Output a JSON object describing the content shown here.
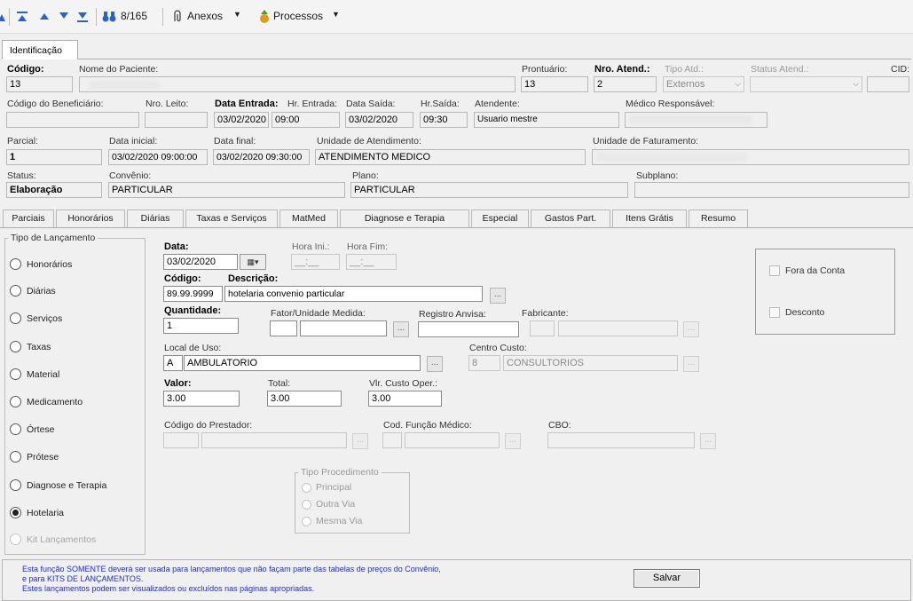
{
  "toolbar": {
    "counter": "8/165",
    "attachments_label": "Anexos",
    "processes_label": "Processos"
  },
  "tabs_top": {
    "identificacao": "Identificação"
  },
  "header": {
    "codigo_label": "Código:",
    "codigo_value": "13",
    "nome_label": "Nome do Paciente:",
    "nome_value": "",
    "prontuario_label": "Prontuário:",
    "prontuario_value": "13",
    "nro_atend_label": "Nro. Atend.:",
    "nro_atend_value": "2",
    "tipo_atd_label": "Tipo Atd.:",
    "tipo_atd_value": "Externos",
    "status_atend_label": "Status Atend.:",
    "status_atend_value": "",
    "cid_label": "CID:",
    "cid_value": "",
    "cod_benef_label": "Código do Beneficiário:",
    "cod_benef_value": "",
    "nro_leito_label": "Nro. Leito:",
    "nro_leito_value": "",
    "data_entrada_label": "Data Entrada:",
    "data_entrada_value": "03/02/2020",
    "hr_entrada_label": "Hr. Entrada:",
    "hr_entrada_value": "09:00",
    "data_saida_label": "Data Saída:",
    "data_saida_value": "03/02/2020",
    "hr_saida_label": "Hr.Saída:",
    "hr_saida_value": "09:30",
    "atendente_label": "Atendente:",
    "atendente_value": "Usuario mestre",
    "medico_label": "Médico Responsável:",
    "medico_value": "",
    "parcial_label": "Parcial:",
    "parcial_value": "1",
    "data_inicial_label": "Data inicial:",
    "data_inicial_value": "03/02/2020 09:00:00",
    "data_final_label": "Data final:",
    "data_final_value": "03/02/2020 09:30:00",
    "unidade_atend_label": "Unidade de Atendimento:",
    "unidade_atend_value": "ATENDIMENTO MEDICO",
    "unidade_fat_label": "Unidade de Faturamento:",
    "unidade_fat_value": "",
    "status_label": "Status:",
    "status_value": "Elaboração",
    "convenio_label": "Convênio:",
    "convenio_value": "PARTICULAR",
    "plano_label": "Plano:",
    "plano_value": "PARTICULAR",
    "subplano_label": "Subplano:",
    "subplano_value": ""
  },
  "lower_tabs": [
    "Parciais",
    "Honorários",
    "Diárias",
    "Taxas e Serviços",
    "MatMed",
    "Diagnose e Terapia",
    "Especial",
    "Gastos Part.",
    "Itens Grátis",
    "Resumo"
  ],
  "tipo_lancamento": {
    "title": "Tipo de Lançamento",
    "options": [
      "Honorários",
      "Diárias",
      "Serviços",
      "Taxas",
      "Material",
      "Medicamento",
      "Órtese",
      "Prótese",
      "Diagnose e Terapia",
      "Hotelaria",
      "Kit Lançamentos"
    ],
    "selected": "Hotelaria"
  },
  "form": {
    "data_label": "Data:",
    "data_value": "03/02/2020",
    "hora_ini_label": "Hora Ini.:",
    "hora_ini_value": "__:__",
    "hora_fim_label": "Hora Fim:",
    "hora_fim_value": "__:__",
    "codigo_label": "Código:",
    "codigo_value": "89.99.9999",
    "descricao_label": "Descrição:",
    "descricao_value": "hotelaria convenio particular",
    "quantidade_label": "Quantidade:",
    "quantidade_value": "1",
    "fator_label": "Fator/Unidade Medida:",
    "registro_label": "Registro Anvisa:",
    "fabricante_label": "Fabricante:",
    "local_uso_label": "Local de Uso:",
    "local_uso_code": "A",
    "local_uso_value": "AMBULATORIO",
    "centro_custo_label": "Centro Custo:",
    "centro_custo_code": "8",
    "centro_custo_value": "CONSULTORIOS",
    "valor_label": "Valor:",
    "valor_value": "3.00",
    "total_label": "Total:",
    "total_value": "3.00",
    "custo_label": "Vlr. Custo Oper.:",
    "custo_value": "3.00",
    "prestador_label": "Código do Prestador:",
    "cod_funcao_label": "Cod. Função Médico:",
    "cbo_label": "CBO:",
    "tipo_proc_title": "Tipo Procedimento",
    "tipo_proc_options": [
      "Principal",
      "Outra Via",
      "Mesma Via"
    ],
    "fora_conta_label": "Fora da Conta",
    "desconto_label": "Desconto",
    "ellipsis": "..."
  },
  "footer": {
    "notice_line1": "Esta função SOMENTE deverá ser usada para lançamentos que não façam parte das tabelas de preços do Convênio,",
    "notice_line2": "e para KITS DE LANÇAMENTOS.",
    "notice_line3": "Estes lançamentos podem ser visualizados ou excluídos nas páginas apropriadas.",
    "save_label": "Salvar"
  },
  "colors": {
    "notice_text": "#1f2fd0",
    "toolbar_icon": "#2a63c4"
  }
}
